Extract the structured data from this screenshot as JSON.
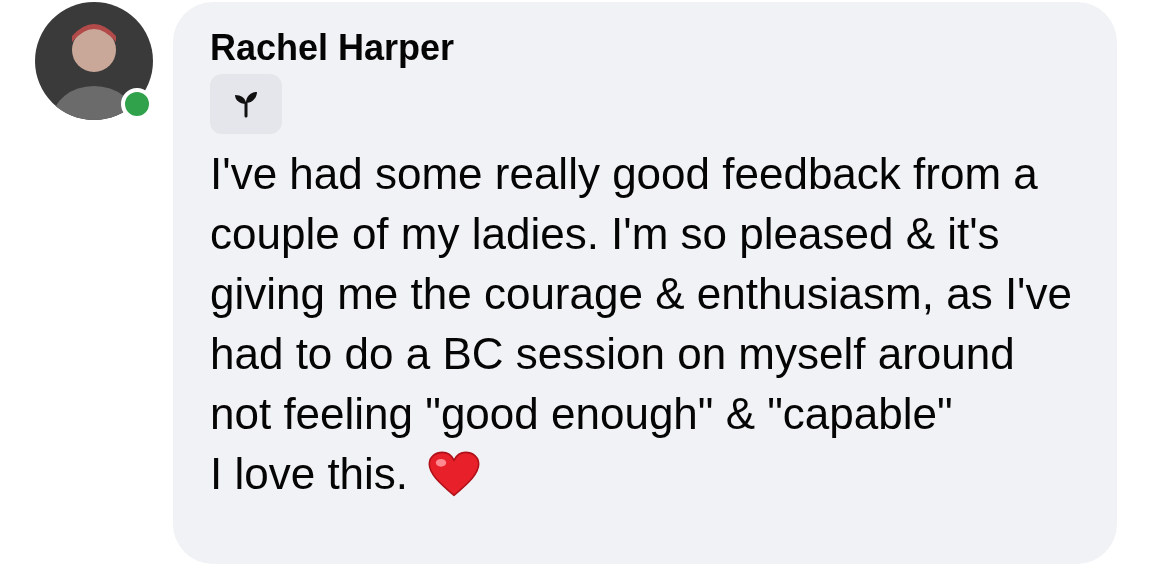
{
  "comment": {
    "author": "Rachel Harper",
    "online": true,
    "badge": {
      "kind": "sprout"
    },
    "paragraphs": [
      {
        "text": "I've had some really good feedback from a couple of my ladies. I'm so pleased & it's giving me the courage & enthusiasm, as I've had to do a BC session on myself around not feeling \"good enough\" & \"capable\"",
        "heart": false
      },
      {
        "text": "I love this.",
        "heart": true
      }
    ]
  }
}
